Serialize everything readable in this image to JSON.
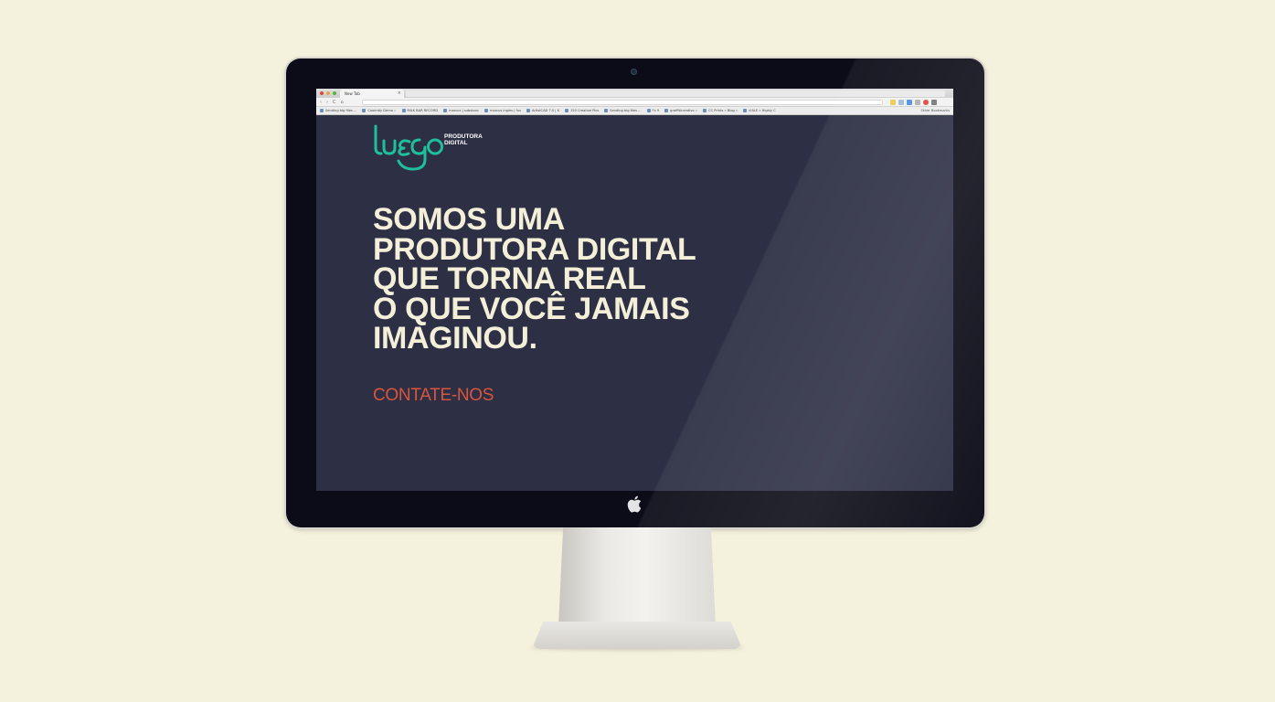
{
  "browser": {
    "tab_title": "New Tab",
    "tab_close": "×",
    "nav": {
      "back": "‹",
      "forward": "›",
      "reload": "C",
      "home": "⌂"
    },
    "bookmarks": [
      "Sending big files ...",
      "Coolmäy Demo ::",
      "MILK BAR RECORD",
      "marcus | substanc",
      "marcus ingles | fus",
      "ArtistCAD 7.0 | K",
      "150 Creative Pics",
      "Sending big files ...",
      "Fx 9",
      "graffiticreativo ::",
      "CC Prints » Blog »",
      "d'ALE » Highly C"
    ],
    "other_bookmarks": "Other Bookmarks"
  },
  "logo": {
    "wordmark": "luego",
    "tagline_line1": "PRODUTORA",
    "tagline_line2": "DIGITAL"
  },
  "headline": {
    "lines": [
      "SOMOS UMA",
      "PRODUTORA DIGITAL",
      "QUE TORNA REAL",
      "O QUE VOCÊ JAMAIS",
      "IMAGINOU."
    ]
  },
  "cta": {
    "label": "CONTATE-NOS"
  },
  "colors": {
    "background": "#f4f1dc",
    "screen": "#2d2f44",
    "logo": "#1fbf9c",
    "headline": "#f3efd9",
    "cta": "#d9553d"
  }
}
